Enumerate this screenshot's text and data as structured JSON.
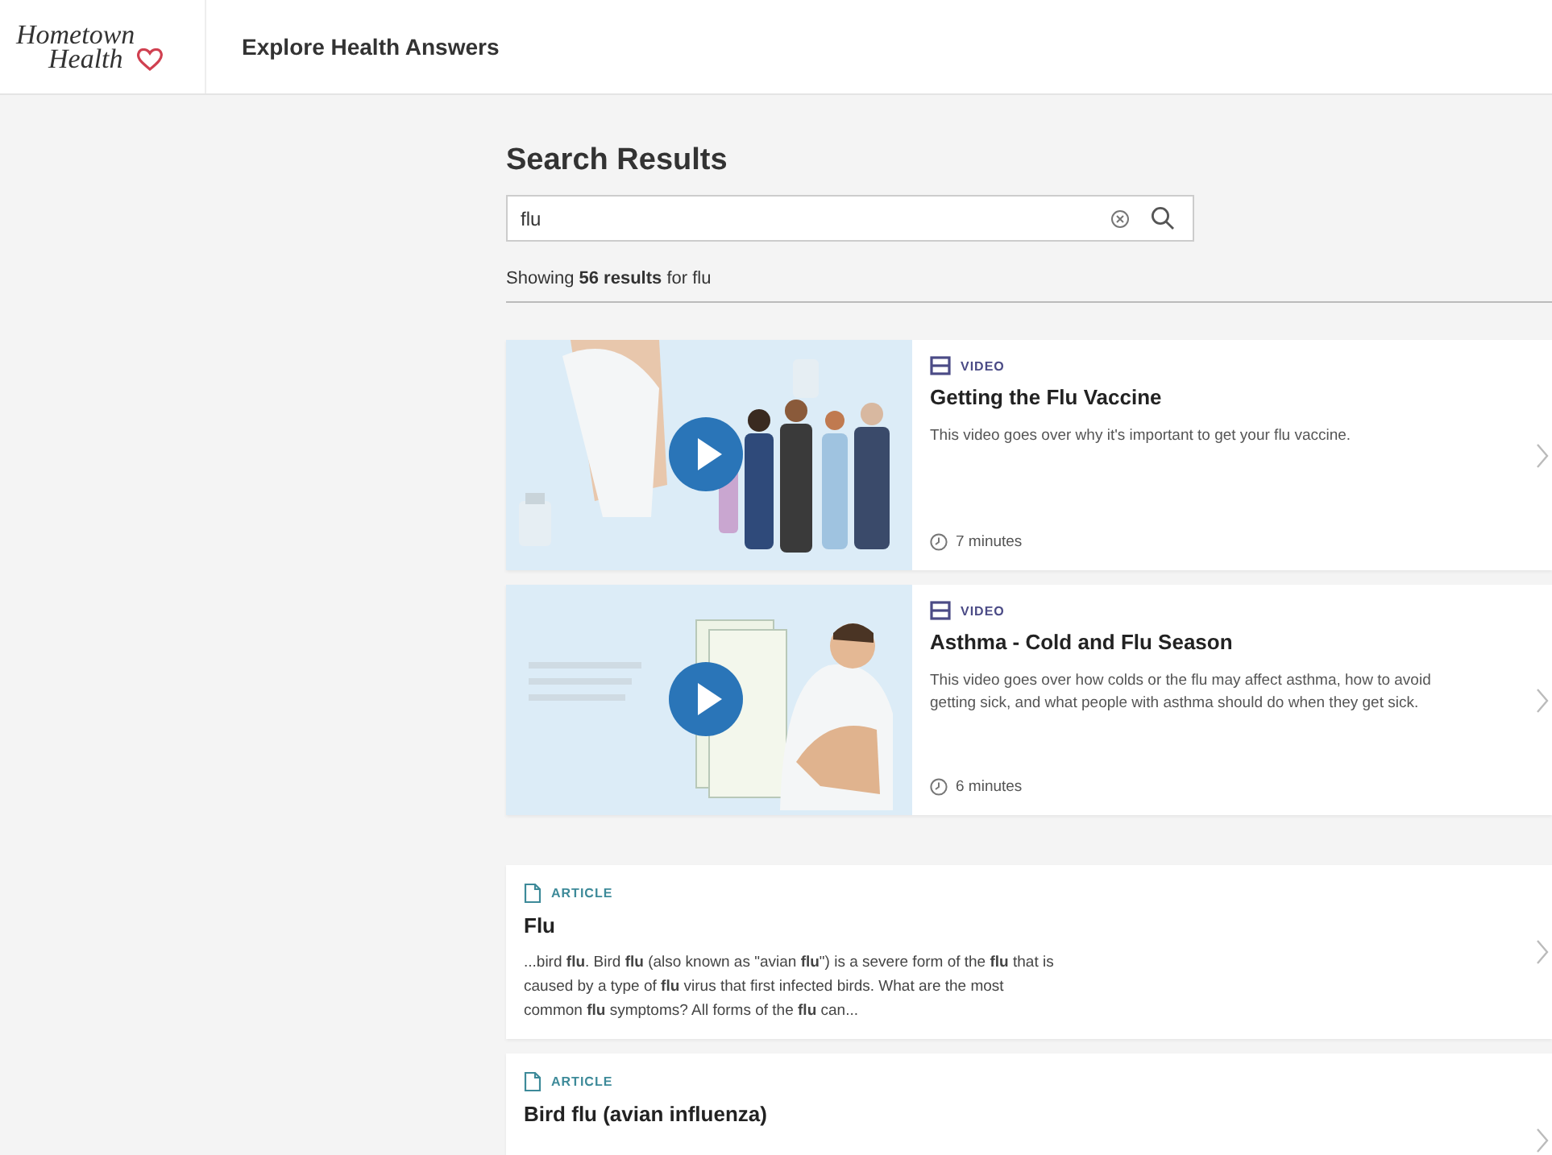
{
  "header": {
    "logo_line_1": "Hometown",
    "logo_line_2": "Health",
    "title": "Explore Health Answers"
  },
  "search": {
    "heading": "Search Results",
    "value": "flu",
    "summary": "Showing **56 results** for flu"
  },
  "results": [
    {
      "kind": "video",
      "type_label": "VIDEO",
      "title": "Getting the Flu Vaccine",
      "description": "This video goes over why it's important to get your flu vaccine.",
      "duration": "7 minutes"
    },
    {
      "kind": "video",
      "type_label": "VIDEO",
      "title": "Asthma - Cold and Flu Season",
      "description": "This video goes over how colds or the flu may affect asthma, how to avoid getting sick, and what people with asthma should do when they get sick.",
      "duration": "6 minutes"
    },
    {
      "kind": "article",
      "type_label": "ARTICLE",
      "title": "Flu",
      "snippet": "...bird **flu**. Bird **flu** (also known as \"avian **flu**\") is a severe form of the **flu** that is caused by a type of **flu** virus that first infected birds. What are the most common **flu** symptoms? All forms of the **flu** can..."
    },
    {
      "kind": "article",
      "type_label": "ARTICLE",
      "title": "Bird flu (avian influenza)"
    }
  ]
}
